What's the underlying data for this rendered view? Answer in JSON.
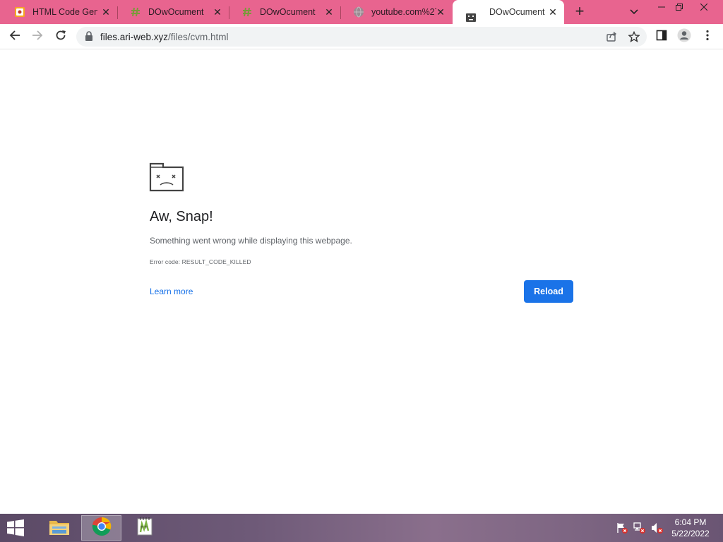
{
  "browser": {
    "tabs": [
      {
        "title": "HTML Code Gene",
        "icon": "html-code-generator-icon",
        "active": false
      },
      {
        "title": "DOwOcument",
        "icon": "hashtag-icon",
        "active": false
      },
      {
        "title": "DOwOcument",
        "icon": "hashtag-icon",
        "active": false
      },
      {
        "title": "youtube.com%27",
        "icon": "globe-icon",
        "active": false
      },
      {
        "title": "DOwOcument",
        "icon": "sad-tab-icon",
        "active": true
      }
    ],
    "tab_close_glyph": "✕",
    "new_tab_glyph": "+",
    "url_host": "files.ari-web.xyz",
    "url_path": "/files/cvm.html"
  },
  "error_page": {
    "title": "Aw, Snap!",
    "message": "Something went wrong while displaying this webpage.",
    "error_code": "Error code: RESULT_CODE_KILLED",
    "learn_more": "Learn more",
    "reload": "Reload"
  },
  "taskbar": {
    "time": "6:04 PM",
    "date": "5/22/2022",
    "apps": [
      "file-explorer-icon",
      "chrome-icon",
      "notepad-plus-plus-icon"
    ]
  },
  "colors": {
    "tabstrip": "#e8648f",
    "accent": "#1a73e8"
  }
}
